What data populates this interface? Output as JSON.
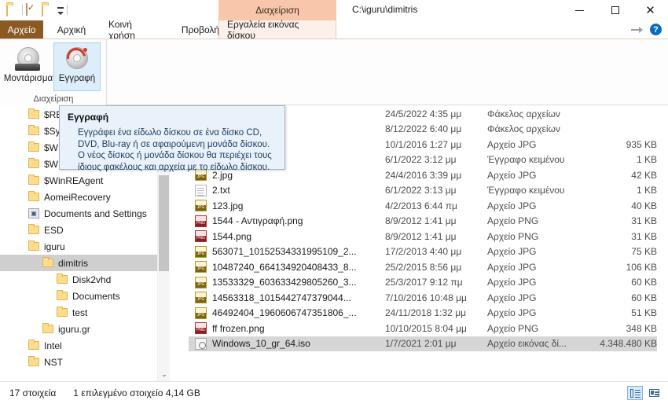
{
  "window": {
    "path_title": "C:\\iguru\\dimitris",
    "minimize_label": "—",
    "maximize_label": "□",
    "close_label": "✕"
  },
  "quick_access": {
    "items": [
      {
        "name": "folder-icon",
        "label": "Φάκελος"
      },
      {
        "name": "properties-icon",
        "label": "Ιδιότητες"
      },
      {
        "name": "new-folder-icon",
        "label": "Νέος φάκελος"
      },
      {
        "name": "customize-qat-icon",
        "label": "Προσαρμογή"
      }
    ]
  },
  "tabs": {
    "contextual_group_label": "Διαχείριση",
    "items": [
      {
        "label": "Αρχείο",
        "active": false,
        "kind": "file"
      },
      {
        "label": "Αρχική",
        "active": false,
        "kind": "normal"
      },
      {
        "label": "Κοινή χρήση",
        "active": false,
        "kind": "normal"
      },
      {
        "label": "Προβολή",
        "active": false,
        "kind": "normal"
      },
      {
        "label": "Εργαλεία εικόνας δίσκου",
        "active": true,
        "kind": "contextual"
      }
    ],
    "collapse_ribbon_label": "Σύμπτυξη κορδέλας",
    "help_label": "?"
  },
  "ribbon": {
    "group_label": "Διαχείριση",
    "buttons": [
      {
        "label": "Μοντάρισμα",
        "icon": "mount-disc-icon",
        "selected": false
      },
      {
        "label": "Εγγραφή",
        "icon": "burn-disc-icon",
        "selected": true
      }
    ]
  },
  "tooltip": {
    "title": "Εγγραφή",
    "body": "Εγγράφει ένα είδωλο δίσκου σε ένα δίσκο CD, DVD, Blu-ray ή σε αφαιρούμενη μονάδα δίσκου. Ο νέος δίσκος ή μονάδα δίσκου θα περιέχει τους ίδιους φακέλους και αρχεία με το είδωλο δίσκου."
  },
  "navigation_pane": {
    "items": [
      {
        "label": "$RE",
        "indent": 1,
        "icon": "folder-icon",
        "selected": false,
        "occluded": true
      },
      {
        "label": "$Sy",
        "indent": 1,
        "icon": "folder-icon",
        "selected": false,
        "occluded": true
      },
      {
        "label": "$W",
        "indent": 1,
        "icon": "folder-icon",
        "selected": false,
        "occluded": true
      },
      {
        "label": "$W",
        "indent": 1,
        "icon": "folder-icon",
        "selected": false,
        "occluded": true
      },
      {
        "label": "$WinREAgent",
        "indent": 1,
        "icon": "folder-icon",
        "selected": false
      },
      {
        "label": "AomeiRecovery",
        "indent": 1,
        "icon": "folder-icon",
        "selected": false
      },
      {
        "label": "Documents and Settings",
        "indent": 1,
        "icon": "shortcut-folder-icon",
        "selected": false
      },
      {
        "label": "ESD",
        "indent": 1,
        "icon": "folder-icon",
        "selected": false
      },
      {
        "label": "iguru",
        "indent": 1,
        "icon": "folder-icon",
        "selected": false
      },
      {
        "label": "dimitris",
        "indent": 2,
        "icon": "folder-icon",
        "selected": true
      },
      {
        "label": "Disk2vhd",
        "indent": 3,
        "icon": "folder-icon",
        "selected": false
      },
      {
        "label": "Documents",
        "indent": 3,
        "icon": "folder-icon",
        "selected": false
      },
      {
        "label": "test",
        "indent": 3,
        "icon": "folder-icon",
        "selected": false
      },
      {
        "label": "iguru.gr",
        "indent": 2,
        "icon": "folder-icon",
        "selected": false
      },
      {
        "label": "Intel",
        "indent": 1,
        "icon": "folder-icon",
        "selected": false
      },
      {
        "label": "NST",
        "indent": 1,
        "icon": "folder-icon",
        "selected": false
      }
    ],
    "scroll_up_label": "▲",
    "scroll_down_label": "⌄"
  },
  "file_list": {
    "rows": [
      {
        "name": "",
        "date": "24/5/2022 4:35 μμ",
        "type": "Φάκελος αρχείων",
        "size": "",
        "icon": "folder-icon",
        "selected": false,
        "occluded": true
      },
      {
        "name": "",
        "date": "8/12/2022 6:40 μμ",
        "type": "Φάκελος αρχείων",
        "size": "",
        "icon": "folder-icon",
        "selected": false,
        "occluded": true
      },
      {
        "name": "",
        "date": "10/1/2016 1:27 μμ",
        "type": "Αρχείο JPG",
        "size": "935 KB",
        "icon": "jpg-file-icon",
        "selected": false,
        "occluded": true
      },
      {
        "name": "",
        "date": "6/1/2022 3:12 μμ",
        "type": "Έγγραφο κειμένου",
        "size": "1 KB",
        "icon": "txt-file-icon",
        "selected": false,
        "occluded": true
      },
      {
        "name": "2.jpg",
        "date": "24/4/2016 3:39 μμ",
        "type": "Αρχείο JPG",
        "size": "42 KB",
        "icon": "jpg-file-icon",
        "selected": false,
        "occluded": false
      },
      {
        "name": "2.txt",
        "date": "6/1/2022 3:13 μμ",
        "type": "Έγγραφο κειμένου",
        "size": "1 KB",
        "icon": "txt-file-icon",
        "selected": false,
        "occluded": false
      },
      {
        "name": "123.jpg",
        "date": "4/2/2013 6:44 πμ",
        "type": "Αρχείο JPG",
        "size": "40 KB",
        "icon": "jpg-file-icon",
        "selected": false,
        "occluded": false
      },
      {
        "name": "1544 - Αντιγραφή.png",
        "date": "8/9/2012 1:41 μμ",
        "type": "Αρχείο PNG",
        "size": "31 KB",
        "icon": "png-file-icon",
        "selected": false,
        "occluded": false
      },
      {
        "name": "1544.png",
        "date": "8/9/2012 1:41 μμ",
        "type": "Αρχείο PNG",
        "size": "31 KB",
        "icon": "png-file-icon",
        "selected": false,
        "occluded": false
      },
      {
        "name": "563071_10152534331995109_2...",
        "date": "17/2/2013 4:40 μμ",
        "type": "Αρχείο JPG",
        "size": "75 KB",
        "icon": "jpg-file-icon",
        "selected": false,
        "occluded": false
      },
      {
        "name": "10487240_664134920408433_8...",
        "date": "25/2/2015 8:56 μμ",
        "type": "Αρχείο JPG",
        "size": "106 KB",
        "icon": "jpg-file-icon",
        "selected": false,
        "occluded": false
      },
      {
        "name": "13533329_603633429805260_3...",
        "date": "25/3/2017 9:12 πμ",
        "type": "Αρχείο JPG",
        "size": "60 KB",
        "icon": "jpg-file-icon",
        "selected": false,
        "occluded": false
      },
      {
        "name": "14563318_1015442747379044...",
        "date": "7/10/2016 10:48 μμ",
        "type": "Αρχείο JPG",
        "size": "60 KB",
        "icon": "jpg-file-icon",
        "selected": false,
        "occluded": false
      },
      {
        "name": "46492404_1960606747351806_...",
        "date": "24/11/2018 1:32 μμ",
        "type": "Αρχείο JPG",
        "size": "51 KB",
        "icon": "jpg-file-icon",
        "selected": false,
        "occluded": false
      },
      {
        "name": "ff frozen.png",
        "date": "10/10/2015 8:04 μμ",
        "type": "Αρχείο PNG",
        "size": "348 KB",
        "icon": "png-file-icon",
        "selected": false,
        "occluded": false
      },
      {
        "name": "Windows_10_gr_64.iso",
        "date": "1/7/2021 2:01 μμ",
        "type": "Αρχείο εικόνας δί...",
        "size": "4.348.480 KB",
        "icon": "iso-file-icon",
        "selected": true,
        "occluded": false
      }
    ]
  },
  "status_bar": {
    "item_count": "17 στοιχεία",
    "selection": "1 επιλεγμένο στοιχείο  4,14 GB",
    "view_details_label": "Λεπτομέρειες",
    "view_tiles_label": "Παράθεση"
  },
  "colors": {
    "contextual_tab": "#f7c6ab",
    "file_tab": "#8a5a22",
    "selection": "#d6d6d6",
    "tooltip_bg": "#e9f2fa",
    "ribbon_selected": "#ddeefb"
  }
}
